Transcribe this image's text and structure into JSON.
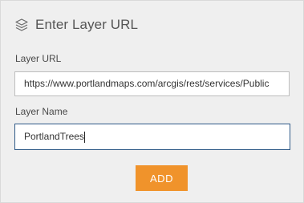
{
  "header": {
    "title": "Enter Layer URL",
    "icon": "layers-icon"
  },
  "form": {
    "url_label": "Layer URL",
    "url_value": "https://www.portlandmaps.com/arcgis/rest/services/Public",
    "name_label": "Layer Name",
    "name_value": "PortlandTrees"
  },
  "actions": {
    "add_label": "ADD"
  },
  "colors": {
    "panel_bg": "#efefef",
    "accent": "#f0932b",
    "focus_border": "#2f5a88"
  }
}
